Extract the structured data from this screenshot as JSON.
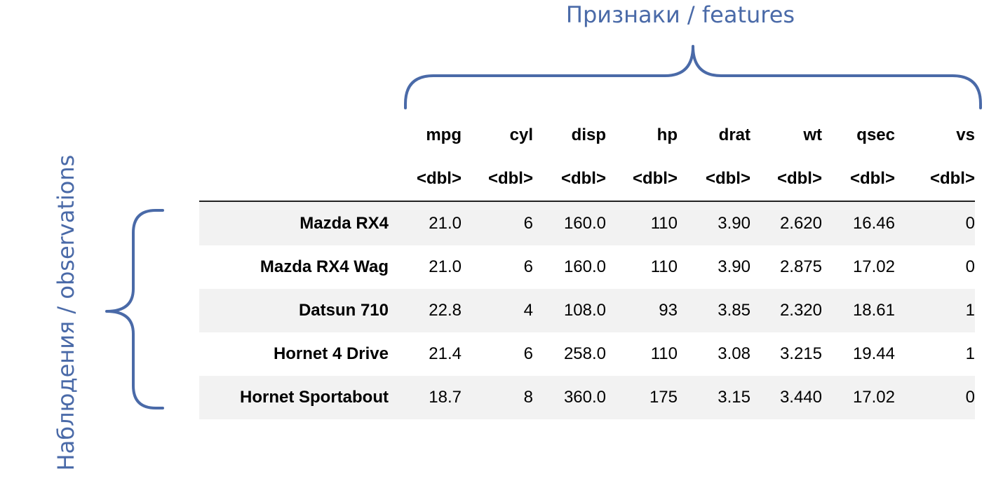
{
  "annotations": {
    "features_label": "Признаки / features",
    "observations_label": "Наблюдения / observations",
    "brace_color": "#4a6aa8"
  },
  "table": {
    "columns": [
      "mpg",
      "cyl",
      "disp",
      "hp",
      "drat",
      "wt",
      "qsec",
      "vs"
    ],
    "types": [
      "<dbl>",
      "<dbl>",
      "<dbl>",
      "<dbl>",
      "<dbl>",
      "<dbl>",
      "<dbl>",
      "<dbl>"
    ],
    "rows": [
      {
        "name": "Mazda RX4",
        "values": [
          "21.0",
          "6",
          "160.0",
          "110",
          "3.90",
          "2.620",
          "16.46",
          "0"
        ]
      },
      {
        "name": "Mazda RX4 Wag",
        "values": [
          "21.0",
          "6",
          "160.0",
          "110",
          "3.90",
          "2.875",
          "17.02",
          "0"
        ]
      },
      {
        "name": "Datsun 710",
        "values": [
          "22.8",
          "4",
          "108.0",
          "93",
          "3.85",
          "2.320",
          "18.61",
          "1"
        ]
      },
      {
        "name": "Hornet 4 Drive",
        "values": [
          "21.4",
          "6",
          "258.0",
          "110",
          "3.08",
          "3.215",
          "19.44",
          "1"
        ]
      },
      {
        "name": "Hornet Sportabout",
        "values": [
          "18.7",
          "8",
          "360.0",
          "175",
          "3.15",
          "3.440",
          "17.02",
          "0"
        ]
      }
    ]
  }
}
